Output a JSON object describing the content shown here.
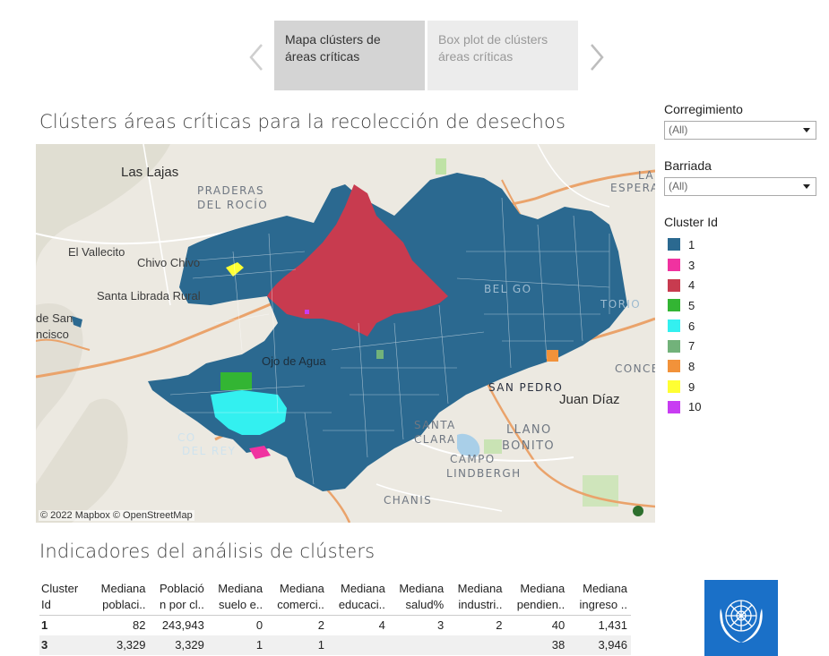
{
  "story": {
    "tabs": [
      {
        "label": "Mapa clústers de áreas críticas",
        "active": true
      },
      {
        "label": "Box plot de clústers áreas críticas",
        "active": false
      }
    ]
  },
  "map_section": {
    "title": "Clústers áreas críticas para la recolección de desechos",
    "attribution": "© 2022 Mapbox  © OpenStreetMap",
    "place_labels": {
      "las_lajas": "Las Lajas",
      "praderas": "PRADERAS",
      "del_rocio": "DEL ROCÍO",
      "el_vallecito": "El Vallecito",
      "chivo_chivo": "Chivo Chivo",
      "santa_librada": "Santa Librada Rural",
      "de_san": "de San",
      "ncisco": "ncisco",
      "ojo_de_agua": "Ojo de Agua",
      "san_pedro": "SAN PEDRO",
      "juan_diaz": "Juan Díaz",
      "santa": "SANTA",
      "clara": "CLARA",
      "llano": "LLANO",
      "bonito": "BONITO",
      "campo": "CAMPO",
      "lindbergh": "LINDBERGH",
      "chanis": "CHANIS",
      "conce": "CONCE",
      "la_right": "LA",
      "espera": "ESPERA",
      "del_rey_1": "CO",
      "del_rey_2": "DEL REY",
      "bel_go": "BEL GO",
      "torio": "TORIO"
    }
  },
  "filters": {
    "corregimiento": {
      "label": "Corregimiento",
      "value": "(All)"
    },
    "barriada": {
      "label": "Barriada",
      "value": "(All)"
    },
    "cluster_legend": {
      "title": "Cluster Id",
      "items": [
        {
          "label": "1",
          "color": "#2b6990"
        },
        {
          "label": "3",
          "color": "#f032a0"
        },
        {
          "label": "4",
          "color": "#c83b4f"
        },
        {
          "label": "5",
          "color": "#33b533"
        },
        {
          "label": "6",
          "color": "#33f0f0"
        },
        {
          "label": "7",
          "color": "#72b27a"
        },
        {
          "label": "8",
          "color": "#f2923a"
        },
        {
          "label": "9",
          "color": "#ffff33"
        },
        {
          "label": "10",
          "color": "#c83cf2"
        }
      ]
    }
  },
  "indicators": {
    "title": "Indicadores del análisis de clústers",
    "headers": [
      [
        "Cluster",
        "Id"
      ],
      [
        "Mediana",
        "poblaci.."
      ],
      [
        "Població",
        "n por cl.."
      ],
      [
        "Mediana",
        "suelo e.."
      ],
      [
        "Mediana",
        "comerci.."
      ],
      [
        "Mediana",
        "educaci.."
      ],
      [
        "Mediana",
        "salud%"
      ],
      [
        "Mediana",
        "industri.."
      ],
      [
        "Mediana",
        "pendien.."
      ],
      [
        "Mediana",
        "ingreso .."
      ]
    ],
    "rows": [
      [
        "1",
        "82",
        "243,943",
        "0",
        "2",
        "4",
        "3",
        "2",
        "40",
        "1,431"
      ],
      [
        "3",
        "3,329",
        "3,329",
        "1",
        "1",
        "",
        "",
        "",
        "38",
        "3,946"
      ]
    ]
  },
  "logo": {
    "name": "un-emblem",
    "color": "#1a70c8"
  }
}
